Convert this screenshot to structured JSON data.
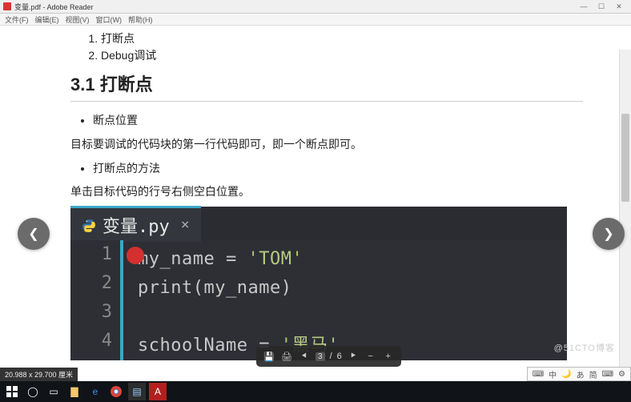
{
  "window": {
    "title": "变量.pdf - Adobe Reader"
  },
  "menu": {
    "file": "文件(F)",
    "edit": "编辑(E)",
    "view": "视图(V)",
    "window": "窗口(W)",
    "help": "帮助(H)"
  },
  "doc": {
    "list1": {
      "i1": "打断点",
      "i2": "Debug调试"
    },
    "heading": "3.1 打断点",
    "bul1": "断点位置",
    "para1": "目标要调试的代码块的第一行代码即可，即一个断点即可。",
    "bul2": "打断点的方法",
    "para2": "单击目标代码的行号右侧空白位置。"
  },
  "editor": {
    "tab": "变量.py",
    "lines": {
      "l1": {
        "n": "1",
        "a": "my_name ",
        "b": "= ",
        "c": "'TOM'"
      },
      "l2": {
        "n": "2",
        "a": "print",
        "b": "(my_name)"
      },
      "l3": {
        "n": "3",
        "a": ""
      },
      "l4": {
        "n": "4",
        "a": "schoolName ",
        "b": "= ",
        "c": "'黑马'"
      }
    }
  },
  "float": {
    "page_cur": "3",
    "page_sep": "/",
    "page_tot": "6"
  },
  "status": {
    "coords": "20.988 x 29.700 厘米"
  },
  "sys": {
    "a": "中",
    "b": "あ",
    "c": "简"
  },
  "watermark": "@51CTO博客"
}
